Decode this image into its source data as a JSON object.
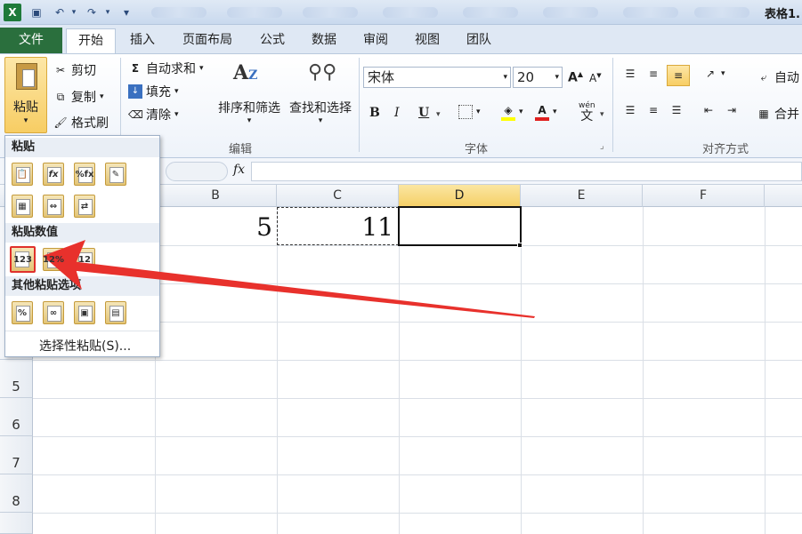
{
  "window": {
    "title": "表格1."
  },
  "quick_access": {
    "app_icon": "X",
    "undo": "↶",
    "redo": "↷",
    "customize": "▾"
  },
  "tabs": [
    "文件",
    "开始",
    "插入",
    "页面布局",
    "公式",
    "数据",
    "审阅",
    "视图",
    "团队"
  ],
  "clipboard": {
    "paste": "粘贴",
    "cut": "剪切",
    "copy": "复制",
    "format_painter": "格式刷"
  },
  "editing": {
    "autosum": "自动求和",
    "fill": "填充",
    "clear": "清除",
    "sort_filter": "排序和筛选",
    "find_select": "查找和选择",
    "label": "编辑"
  },
  "font": {
    "name": "宋体",
    "size": "20",
    "bold": "B",
    "italic": "I",
    "underline": "U",
    "label": "字体",
    "pinyin": "wén",
    "pinyin_char": "文"
  },
  "alignment": {
    "wrap": "自动",
    "merge": "合并",
    "label": "对齐方式"
  },
  "formula_bar": {
    "fx": "fx"
  },
  "columns": [
    "B",
    "C",
    "D",
    "E",
    "F"
  ],
  "rows": [
    "5",
    "6",
    "7",
    "8"
  ],
  "cells": {
    "B1": "5",
    "C1": "11"
  },
  "paste_menu": {
    "section_paste": "粘贴",
    "section_values": "粘贴数值",
    "section_other": "其他粘贴选项",
    "special": "选择性粘贴(S)...",
    "paste_icons": [
      "📋",
      "fx",
      "%fx",
      "✎"
    ],
    "paste_icons_row2": [
      "▦",
      "⇔",
      "⇄"
    ],
    "values_icons": [
      "123",
      "12%",
      "12"
    ],
    "other_icons": [
      "%",
      "∞",
      "▣",
      "▤"
    ]
  },
  "colors": {
    "file_tab": "#2a6f3d",
    "selection": "#f5cf65",
    "arrow": "#e8312c",
    "highlight": "#e0302b"
  }
}
